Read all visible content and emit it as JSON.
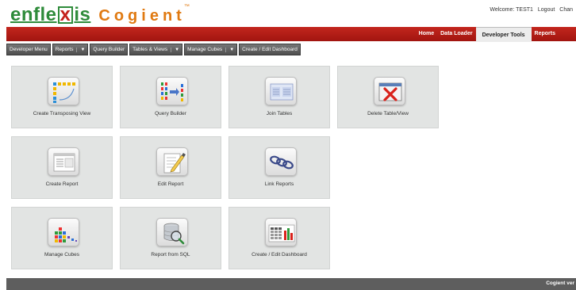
{
  "header": {
    "brand": "enflexis",
    "brand_x": "x",
    "product": "Cogient",
    "tm": "™",
    "welcome": "Welcome: TEST1",
    "logout": "Logout",
    "change": "Chan"
  },
  "topnav": {
    "home": "Home",
    "data_loader": "Data Loader",
    "developer_tools": "Developer Tools",
    "reports": "Reports"
  },
  "menubar": {
    "developer_menu": "Developer Menu",
    "reports": "Reports",
    "query_builder": "Query Builder",
    "tables_views": "Tables & Views",
    "manage_cubes": "Manage Cubes",
    "dashboard": "Create / Edit Dashboard"
  },
  "tiles": [
    {
      "label": "Create Transposing View",
      "icon": "transpose-view-icon"
    },
    {
      "label": "Query Builder",
      "icon": "query-builder-icon"
    },
    {
      "label": "Join Tables",
      "icon": "join-tables-icon"
    },
    {
      "label": "Delete Table/View",
      "icon": "delete-table-icon"
    },
    {
      "label": "Create Report",
      "icon": "create-report-icon"
    },
    {
      "label": "Edit Report",
      "icon": "edit-report-icon"
    },
    {
      "label": "Link Reports",
      "icon": "link-reports-icon"
    },
    {
      "label": "Manage Cubes",
      "icon": "manage-cubes-icon"
    },
    {
      "label": "Report from SQL",
      "icon": "sql-report-icon"
    },
    {
      "label": "Create / Edit Dashboard",
      "icon": "dashboard-icon"
    }
  ],
  "colors": {
    "nav_red": "#b31d15",
    "brand_green": "#2e8b3a",
    "brand_orange": "#e07a12",
    "tile_bg": "#e2e4e3",
    "footer_bg": "#5e5e5e"
  },
  "footer": {
    "text": "Cogient ver"
  }
}
